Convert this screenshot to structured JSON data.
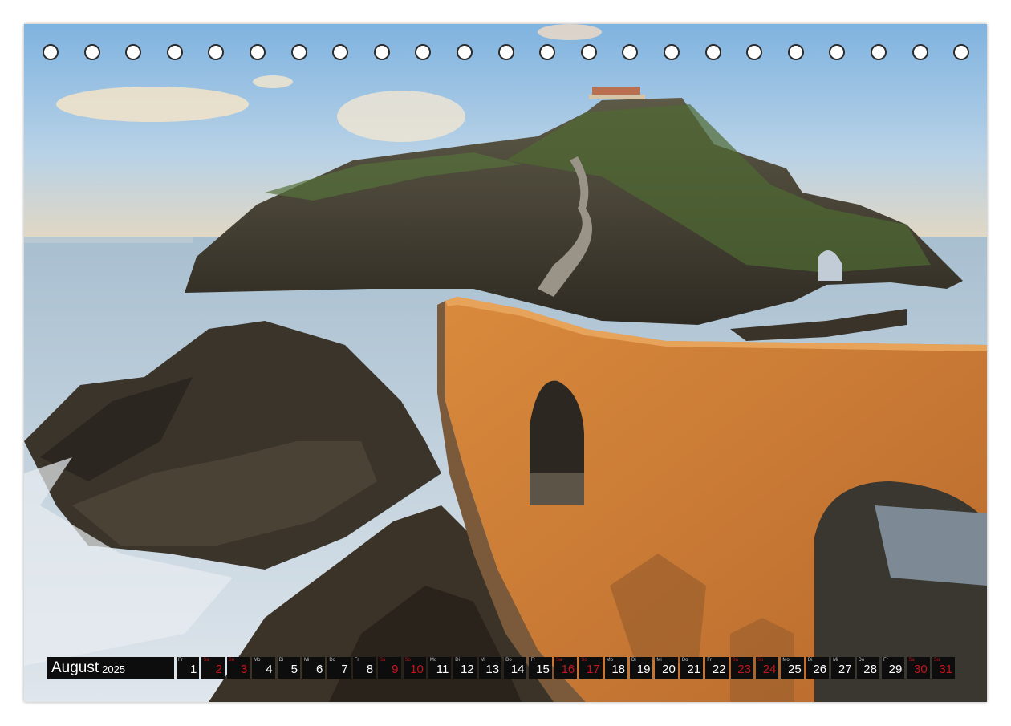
{
  "calendar": {
    "month": "August",
    "year": "2025",
    "days": [
      {
        "wd": "Fr",
        "d": "1",
        "red": false
      },
      {
        "wd": "Sa",
        "d": "2",
        "red": true
      },
      {
        "wd": "So",
        "d": "3",
        "red": true
      },
      {
        "wd": "Mo",
        "d": "4",
        "red": false
      },
      {
        "wd": "Di",
        "d": "5",
        "red": false
      },
      {
        "wd": "Mi",
        "d": "6",
        "red": false
      },
      {
        "wd": "Do",
        "d": "7",
        "red": false
      },
      {
        "wd": "Fr",
        "d": "8",
        "red": false
      },
      {
        "wd": "Sa",
        "d": "9",
        "red": true
      },
      {
        "wd": "So",
        "d": "10",
        "red": true
      },
      {
        "wd": "Mo",
        "d": "11",
        "red": false
      },
      {
        "wd": "Di",
        "d": "12",
        "red": false
      },
      {
        "wd": "Mi",
        "d": "13",
        "red": false
      },
      {
        "wd": "Do",
        "d": "14",
        "red": false
      },
      {
        "wd": "Fr",
        "d": "15",
        "red": false
      },
      {
        "wd": "Sa",
        "d": "16",
        "red": true
      },
      {
        "wd": "So",
        "d": "17",
        "red": true
      },
      {
        "wd": "Mo",
        "d": "18",
        "red": false
      },
      {
        "wd": "Di",
        "d": "19",
        "red": false
      },
      {
        "wd": "Mi",
        "d": "20",
        "red": false
      },
      {
        "wd": "Do",
        "d": "21",
        "red": false
      },
      {
        "wd": "Fr",
        "d": "22",
        "red": false
      },
      {
        "wd": "Sa",
        "d": "23",
        "red": true
      },
      {
        "wd": "So",
        "d": "24",
        "red": true
      },
      {
        "wd": "Mo",
        "d": "25",
        "red": false
      },
      {
        "wd": "Di",
        "d": "26",
        "red": false
      },
      {
        "wd": "Mi",
        "d": "27",
        "red": false
      },
      {
        "wd": "Do",
        "d": "28",
        "red": false
      },
      {
        "wd": "Fr",
        "d": "29",
        "red": false
      },
      {
        "wd": "Sa",
        "d": "30",
        "red": true
      },
      {
        "wd": "So",
        "d": "31",
        "red": true
      }
    ]
  },
  "binding_holes": 23,
  "colors": {
    "weekend": "#c0151b",
    "cell_bg": "#0d0d0d",
    "text": "#ffffff"
  }
}
